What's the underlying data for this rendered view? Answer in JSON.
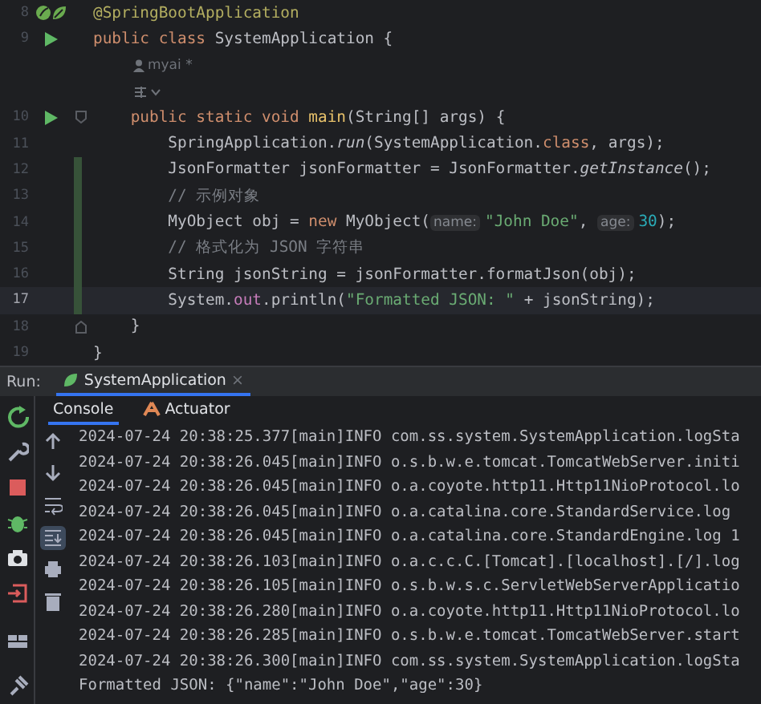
{
  "editor": {
    "lines": [
      {
        "kind": "code",
        "number": "8",
        "spring": true,
        "runnable": false,
        "fold_start": false,
        "fold_end": false,
        "changed": false,
        "current": false,
        "tokens": [
          {
            "text": "@SpringBootApplication",
            "kind": "annotation"
          }
        ]
      },
      {
        "kind": "code",
        "number": "9",
        "spring": false,
        "runnable": true,
        "fold_start": false,
        "fold_end": false,
        "changed": false,
        "current": false,
        "tokens": [
          {
            "text": "public class ",
            "kind": "keyword"
          },
          {
            "text": "SystemApplication {",
            "kind": "plain"
          }
        ]
      },
      {
        "kind": "author",
        "author": "myai *"
      },
      {
        "kind": "action"
      },
      {
        "kind": "code",
        "number": "10",
        "spring": false,
        "runnable": true,
        "fold_start": true,
        "fold_end": false,
        "changed": false,
        "current": false,
        "tokens": [
          {
            "text": "    public static void ",
            "kind": "keyword"
          },
          {
            "text": "main",
            "kind": "method"
          },
          {
            "text": "(String[] args) {",
            "kind": "plain"
          }
        ]
      },
      {
        "kind": "code",
        "number": "11",
        "spring": false,
        "runnable": false,
        "fold_start": false,
        "fold_end": false,
        "changed": false,
        "current": false,
        "tokens": [
          {
            "text": "        SpringApplication.",
            "kind": "plain"
          },
          {
            "text": "run",
            "kind": "static"
          },
          {
            "text": "(SystemApplication.",
            "kind": "plain"
          },
          {
            "text": "class",
            "kind": "keyword"
          },
          {
            "text": ", args);",
            "kind": "plain"
          }
        ]
      },
      {
        "kind": "code",
        "number": "12",
        "spring": false,
        "runnable": false,
        "fold_start": false,
        "fold_end": false,
        "changed": true,
        "current": false,
        "tokens": [
          {
            "text": "        JsonFormatter jsonFormatter = JsonFormatter.",
            "kind": "plain"
          },
          {
            "text": "getInstance",
            "kind": "static"
          },
          {
            "text": "();",
            "kind": "plain"
          }
        ]
      },
      {
        "kind": "code",
        "number": "13",
        "spring": false,
        "runnable": false,
        "fold_start": false,
        "fold_end": false,
        "changed": true,
        "current": false,
        "tokens": [
          {
            "text": "        // 示例对象",
            "kind": "comment"
          }
        ]
      },
      {
        "kind": "code",
        "number": "14",
        "spring": false,
        "runnable": false,
        "fold_start": false,
        "fold_end": false,
        "changed": true,
        "current": false,
        "tokens": [
          {
            "text": "        MyObject obj = ",
            "kind": "plain"
          },
          {
            "text": "new ",
            "kind": "keyword"
          },
          {
            "text": "MyObject(",
            "kind": "plain"
          },
          {
            "text": "name:",
            "kind": "hint"
          },
          {
            "text": "\"John Doe\"",
            "kind": "string"
          },
          {
            "text": ", ",
            "kind": "plain"
          },
          {
            "text": "age:",
            "kind": "hint"
          },
          {
            "text": "30",
            "kind": "number"
          },
          {
            "text": ");",
            "kind": "plain"
          }
        ]
      },
      {
        "kind": "code",
        "number": "15",
        "spring": false,
        "runnable": false,
        "fold_start": false,
        "fold_end": false,
        "changed": true,
        "current": false,
        "tokens": [
          {
            "text": "        // 格式化为 JSON 字符串",
            "kind": "comment"
          }
        ]
      },
      {
        "kind": "code",
        "number": "16",
        "spring": false,
        "runnable": false,
        "fold_start": false,
        "fold_end": false,
        "changed": true,
        "current": false,
        "tokens": [
          {
            "text": "        String jsonString = jsonFormatter.formatJson(obj);",
            "kind": "plain"
          }
        ]
      },
      {
        "kind": "code",
        "number": "17",
        "spring": false,
        "runnable": false,
        "fold_start": false,
        "fold_end": false,
        "changed": true,
        "current": true,
        "tokens": [
          {
            "text": "        System.",
            "kind": "plain"
          },
          {
            "text": "out",
            "kind": "field"
          },
          {
            "text": ".println(",
            "kind": "plain"
          },
          {
            "text": "\"Formatted JSON: \"",
            "kind": "string"
          },
          {
            "text": " + jsonString);",
            "kind": "plain"
          }
        ]
      },
      {
        "kind": "code",
        "number": "18",
        "spring": false,
        "runnable": false,
        "fold_start": false,
        "fold_end": true,
        "changed": false,
        "current": false,
        "tokens": [
          {
            "text": "    }",
            "kind": "plain"
          }
        ]
      },
      {
        "kind": "code",
        "number": "19",
        "spring": false,
        "runnable": false,
        "fold_start": false,
        "fold_end": false,
        "changed": false,
        "current": false,
        "tokens": [
          {
            "text": "}",
            "kind": "plain"
          }
        ]
      }
    ]
  },
  "run_panel": {
    "label": "Run:",
    "tabs": [
      {
        "label": "SystemApplication",
        "close": "×",
        "selected": true
      }
    ],
    "console_tabs": [
      {
        "label": "Console",
        "selected": true
      },
      {
        "label": "Actuator",
        "selected": false
      }
    ],
    "console_actions": [
      {
        "on": false
      },
      {
        "on": false
      },
      {
        "on": false
      },
      {
        "on": true
      },
      {
        "on": false
      },
      {
        "on": false
      }
    ],
    "console_lines": [
      "2024-07-24 20:38:25.377[main]INFO com.ss.system.SystemApplication.logSta",
      "2024-07-24 20:38:26.045[main]INFO o.s.b.w.e.tomcat.TomcatWebServer.initi",
      "2024-07-24 20:38:26.045[main]INFO o.a.coyote.http11.Http11NioProtocol.lo",
      "2024-07-24 20:38:26.045[main]INFO o.a.catalina.core.StandardService.log",
      "2024-07-24 20:38:26.045[main]INFO o.a.catalina.core.StandardEngine.log 1",
      "2024-07-24 20:38:26.103[main]INFO o.a.c.c.C.[Tomcat].[localhost].[/].log",
      "2024-07-24 20:38:26.105[main]INFO o.s.b.w.s.c.ServletWebServerApplicatio",
      "2024-07-24 20:38:26.280[main]INFO o.a.coyote.http11.Http11NioProtocol.lo",
      "2024-07-24 20:38:26.285[main]INFO o.s.b.w.e.tomcat.TomcatWebServer.start",
      "2024-07-24 20:38:26.300[main]INFO com.ss.system.SystemApplication.logSta",
      "Formatted JSON: {\"name\":\"John Doe\",\"age\":30}"
    ]
  }
}
